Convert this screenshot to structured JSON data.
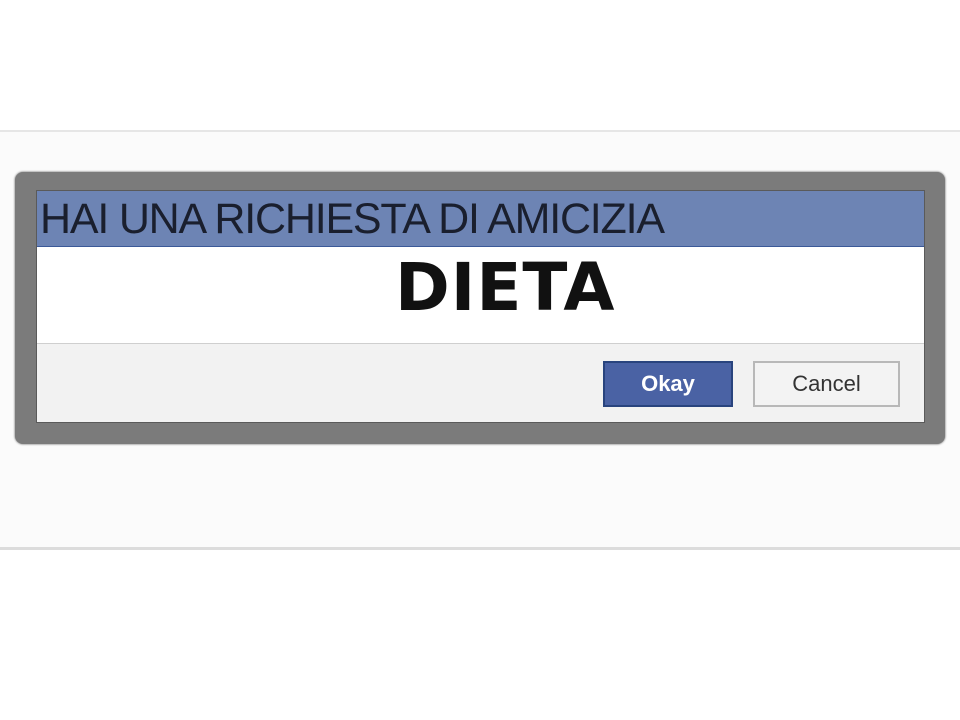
{
  "dialog": {
    "title": "HAI UNA RICHIESTA DI AMICIZIA",
    "message": "DIETA",
    "buttons": {
      "okay_label": "Okay",
      "cancel_label": "Cancel"
    }
  },
  "colors": {
    "header_background": "#6d84b4",
    "primary_button": "#4a62a4",
    "frame": "#7b7b7b"
  }
}
